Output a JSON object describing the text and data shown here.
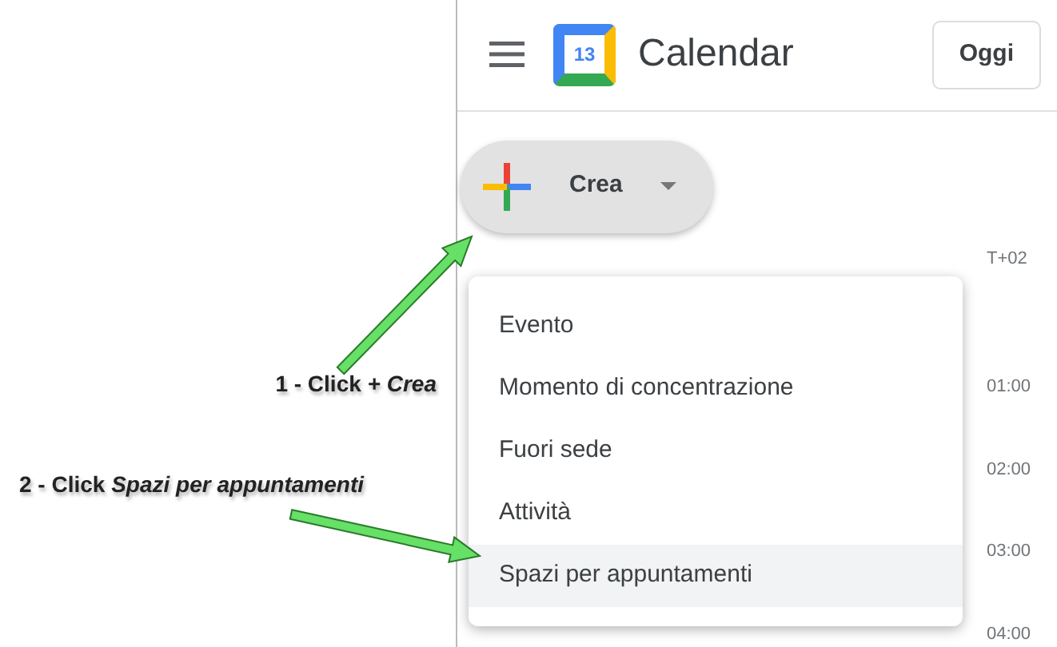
{
  "header": {
    "logo_day": "13",
    "app_name": "Calendar",
    "today_button": "Oggi"
  },
  "create_button": {
    "label": "Crea"
  },
  "create_menu": {
    "items": [
      {
        "label": "Evento",
        "selected": false
      },
      {
        "label": "Momento di concentrazione",
        "selected": false
      },
      {
        "label": "Fuori sede",
        "selected": false
      },
      {
        "label": "Attività",
        "selected": false
      },
      {
        "label": "Spazi per appuntamenti",
        "selected": true
      }
    ]
  },
  "timezone_label": "T+02",
  "time_labels": [
    "01:00",
    "02:00",
    "03:00",
    "04:00"
  ],
  "annotations": [
    {
      "text": "1 - Click *+ Crea*"
    },
    {
      "text": "2 - Click *Spazi per appuntamenti*"
    }
  ]
}
